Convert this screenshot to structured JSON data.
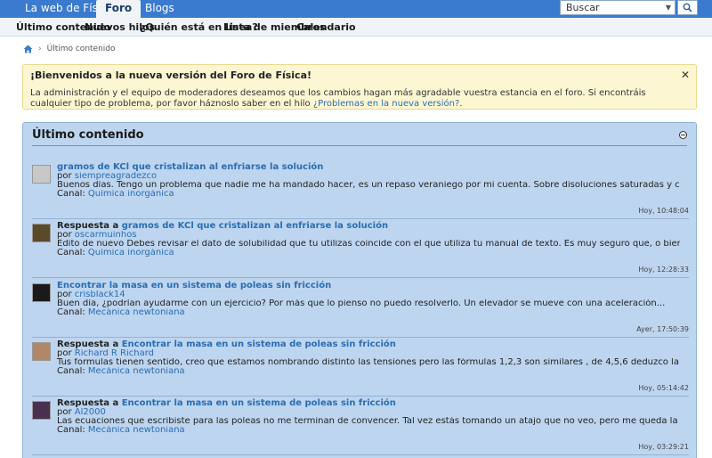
{
  "topnav": {
    "tabs": [
      {
        "label": "La web de Física"
      },
      {
        "label": "Foro"
      },
      {
        "label": "Blogs"
      }
    ],
    "search": {
      "placeholder": "Buscar"
    }
  },
  "subnav": {
    "items": [
      {
        "label": "Último contenido"
      },
      {
        "label": "Nuevos hilos"
      },
      {
        "label": "¿Quién está en línea?"
      },
      {
        "label": "Lista de miembros"
      },
      {
        "label": "Calendario"
      }
    ]
  },
  "breadcrumb": {
    "current": "Último contenido"
  },
  "notice": {
    "title": "¡Bienvenidos a la nueva versión del Foro de Física!",
    "body": "La administración y el equipo de moderadores deseamos que los cambios hagan más agradable vuestra estancia en el foro. Si encontráis cualquier tipo de problema, por favor háznoslo saber en el hilo",
    "link": "¿Problemas en la nueva versión?",
    "end": ".",
    "close": "✕"
  },
  "panel": {
    "title": "Último contenido",
    "items": [
      {
        "prefix": "",
        "title": "gramos de KCl que cristalizan al enfriarse la solución",
        "by": "por",
        "author": "siempreagradezco",
        "excerpt": "Buenos días. Tengo un problema que nadie me ha mandado hacer, es un repaso veraniego por mi cuenta. Sobre disoluciones saturadas y cristalización. Reza...",
        "channel_label": "Canal:",
        "channel": "Química inorgánica",
        "time": "Hoy, 10:48:04",
        "avatar_color": "#c8c8c8"
      },
      {
        "prefix": "Respuesta a",
        "title": "gramos de KCl que cristalizan al enfriarse la solución",
        "by": "por",
        "author": "oscarmuinhos",
        "excerpt": "Edito de nuevo Debes revisar el dato de solubilidad que tu utilizas coincide con el que utiliza tu manual de texto. Es muy seguro que, o bien te...",
        "channel_label": "Canal:",
        "channel": "Química inorgánica",
        "time": "Hoy, 12:28:33",
        "avatar_color": "#5a4a2a"
      },
      {
        "prefix": "",
        "title": "Encontrar la masa en un sistema de poleas sin fricción",
        "by": "por",
        "author": "crisblack14",
        "excerpt": "Buen día, ¿podrían ayudarme con un ejercicio? Por más que lo pienso no puedo resolverlo. Un elevador se mueve con una aceleración...",
        "channel_label": "Canal:",
        "channel": "Mecánica newtoniana",
        "time": "Ayer, 17:50:39",
        "avatar_color": "#1a1a1a"
      },
      {
        "prefix": "Respuesta a",
        "title": "Encontrar la masa en un sistema de poleas sin fricción",
        "by": "por",
        "author": "Richard R Richard",
        "excerpt": "Tus formulas tienen sentido, creo que estamos nombrando distinto las tensiones pero las fórmulas 1,2,3 son similares , de 4,5,6 deduzco la 4 tuya,...",
        "channel_label": "Canal:",
        "channel": "Mecánica newtoniana",
        "time": "Hoy, 05:14:42",
        "avatar_color": "#b08868"
      },
      {
        "prefix": "Respuesta a",
        "title": "Encontrar la masa en un sistema de poleas sin fricción",
        "by": "por",
        "author": "Al2000",
        "excerpt": "Las ecuaciones que escribiste para las poleas no me terminan de convencer. Tal vez estás tomando un atajo que no veo, pero me queda la duda de su validez...",
        "channel_label": "Canal:",
        "channel": "Mecánica newtoniana",
        "time": "Hoy, 03:29:21",
        "avatar_color": "#4a3050"
      }
    ]
  }
}
